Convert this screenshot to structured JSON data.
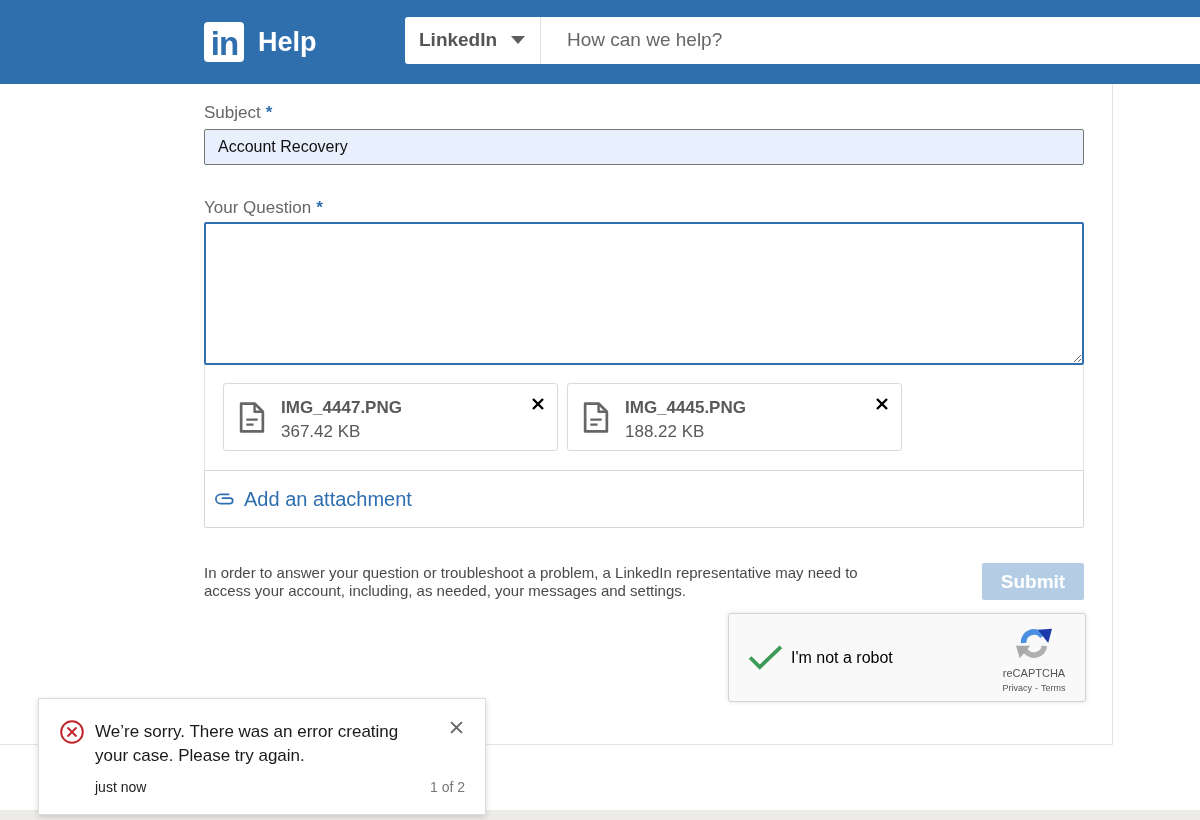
{
  "header": {
    "logo": "in",
    "title": "Help",
    "search": {
      "scope": "LinkedIn",
      "placeholder": "How can we help?"
    }
  },
  "form": {
    "subject": {
      "label": "Subject",
      "required_mark": "*",
      "value": "Account Recovery",
      "autofilled": true
    },
    "question": {
      "label": "Your Question",
      "required_mark": "*",
      "focused": true
    },
    "attachments": [
      {
        "name": "IMG_4447.PNG",
        "size": "367.42 KB"
      },
      {
        "name": "IMG_4445.PNG",
        "size": "188.22 KB"
      }
    ],
    "add_attachment": "Add an attachment",
    "notice": "In order to answer your question or troubleshoot a problem, a LinkedIn representative may need to access your account, including, as needed, your messages and settings.",
    "submit": {
      "label": "Submit",
      "disabled": true
    },
    "captcha": {
      "checked": true,
      "label": "I'm not a robot",
      "brand": "reCAPTCHA",
      "privacy": "Privacy",
      "separator": "-",
      "terms": "Terms"
    }
  },
  "toast": {
    "kind": "error",
    "message": "We’re sorry. There was an error creating your case. Please try again.",
    "time": "just now",
    "counter": "1 of 2"
  }
}
